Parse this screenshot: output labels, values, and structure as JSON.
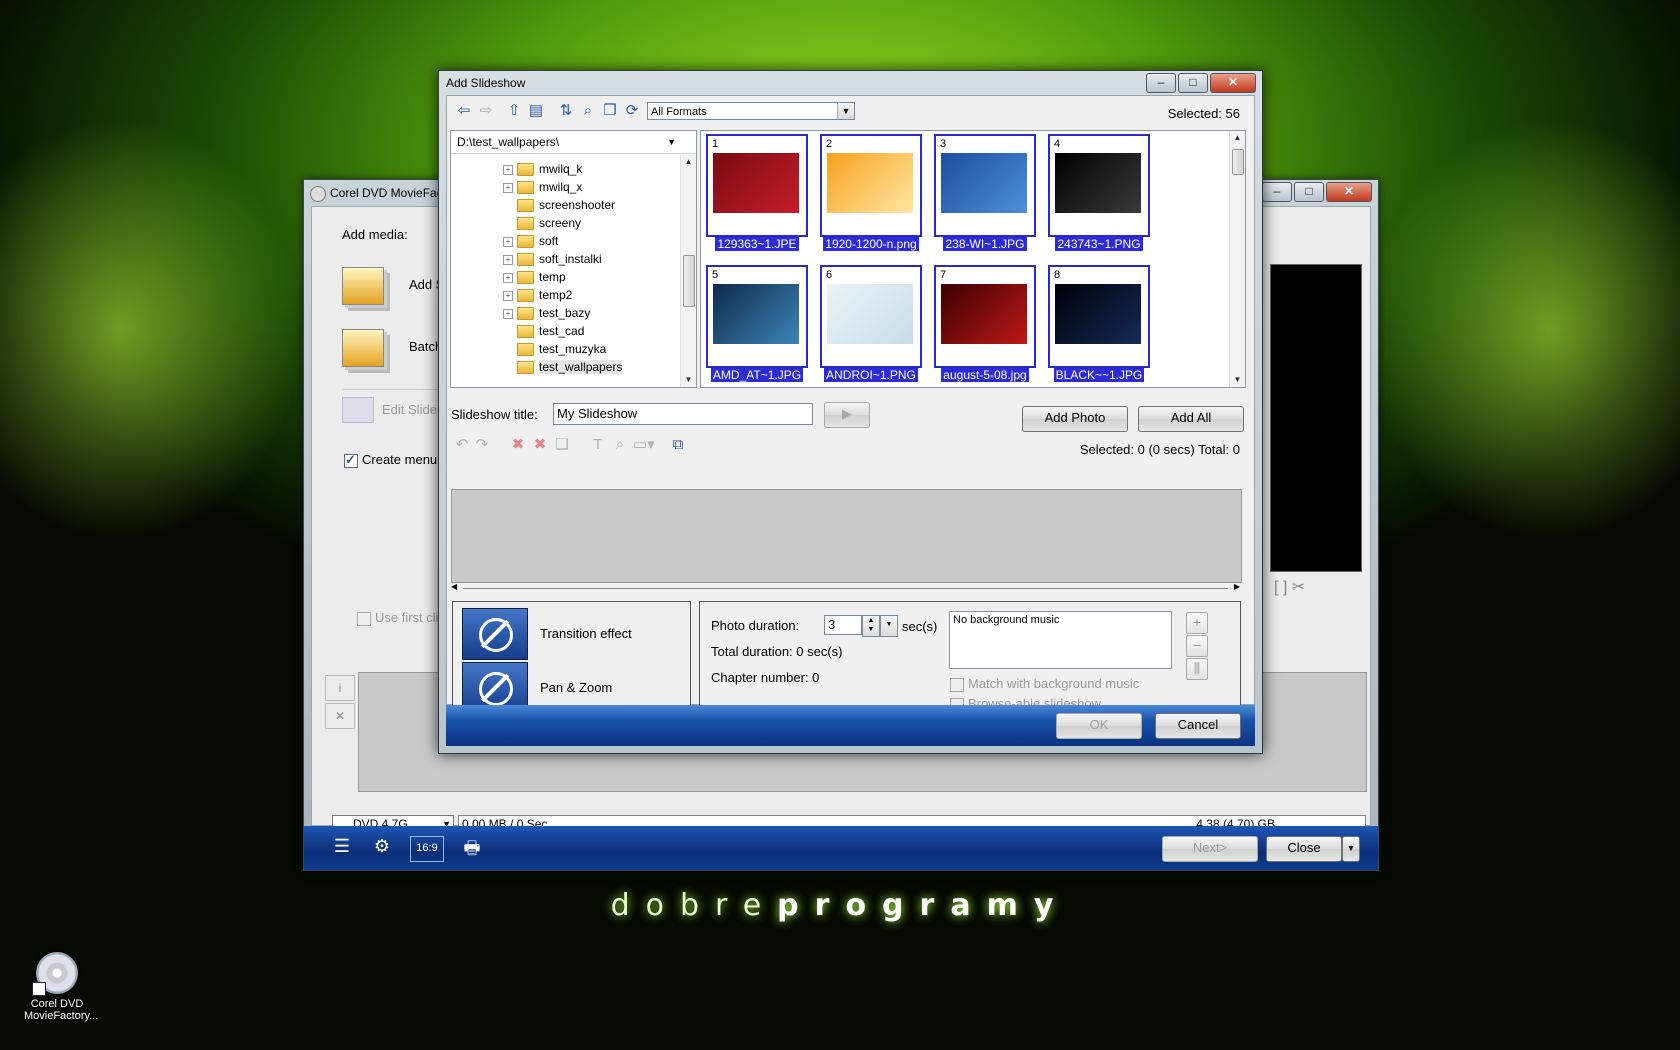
{
  "desktop": {
    "logo_light": "dobre",
    "logo_bold": "programy",
    "icon_label_1": "Corel DVD",
    "icon_label_2": "MovieFactory..."
  },
  "main_window": {
    "title": "Corel DVD MovieFac",
    "add_media_label": "Add media:",
    "add_slideshow_label": "Add S",
    "batch_label": "Batch",
    "edit_slideshow_label": "Edit Slide",
    "create_menu_label": "Create menu",
    "use_first_clip_label": "Use first cli",
    "disc_type": "DVD 4.7G",
    "usage_text": "0.00 MB / 0 Sec",
    "capacity_text": "4.38 (4.70) GB",
    "next_button": "Next>",
    "close_button": "Close",
    "aspect_button": "16:9"
  },
  "dialog": {
    "title": "Add Slideshow",
    "format_filter": "All Formats",
    "selected_count": "Selected: 56",
    "folder_path": "D:\\test_wallpapers\\",
    "tree_items": [
      {
        "name": "mwilq_k",
        "expandable": true
      },
      {
        "name": "mwilq_x",
        "expandable": true
      },
      {
        "name": "screenshooter",
        "expandable": false
      },
      {
        "name": "screeny",
        "expandable": false
      },
      {
        "name": "soft",
        "expandable": true
      },
      {
        "name": "soft_instalki",
        "expandable": true
      },
      {
        "name": "temp",
        "expandable": true
      },
      {
        "name": "temp2",
        "expandable": true
      },
      {
        "name": "test_bazy",
        "expandable": true
      },
      {
        "name": "test_cad",
        "expandable": false
      },
      {
        "name": "test_muzyka",
        "expandable": false
      },
      {
        "name": "test_wallpapers",
        "expandable": false,
        "selected": true
      }
    ],
    "thumbnails": [
      {
        "num": "1",
        "file": "129363~1.JPE",
        "color1": "#7a0a12",
        "color2": "#c41e2a"
      },
      {
        "num": "2",
        "file": "1920-1200-n.png",
        "color1": "#f7a21b",
        "color2": "#ffe7a6"
      },
      {
        "num": "3",
        "file": "238-WI~1.JPG",
        "color1": "#1b4f9e",
        "color2": "#4e8fd6"
      },
      {
        "num": "4",
        "file": "243743~1.PNG",
        "color1": "#000000",
        "color2": "#3a3a3a"
      },
      {
        "num": "5",
        "file": "AMD_AT~1.JPG",
        "color1": "#0f2a4a",
        "color2": "#3b86b5"
      },
      {
        "num": "6",
        "file": "ANDROI~1.PNG",
        "color1": "#e9f3f8",
        "color2": "#c9dde7"
      },
      {
        "num": "7",
        "file": "august-5-08.jpg",
        "color1": "#3a0000",
        "color2": "#c01818"
      },
      {
        "num": "8",
        "file": "BLACK~~1.JPG",
        "color1": "#000008",
        "color2": "#142a55"
      }
    ],
    "slideshow_title_label": "Slideshow title:",
    "slideshow_title_value": "My Slideshow",
    "add_photo_button": "Add Photo",
    "add_all_button": "Add All",
    "selection_status": "Selected: 0 (0 secs)  Total: 0",
    "transition_effect_label": "Transition effect",
    "pan_zoom_label": "Pan & Zoom",
    "photo_duration_label": "Photo duration:",
    "photo_duration_value": "3",
    "secs_label": "sec(s)",
    "total_duration": "Total duration: 0 sec(s)",
    "chapter_number": "Chapter number: 0",
    "music_text": "No background music",
    "match_music_label": "Match with background music",
    "browseable_label": "Browse-able slideshow",
    "ok_button": "OK",
    "cancel_button": "Cancel"
  }
}
